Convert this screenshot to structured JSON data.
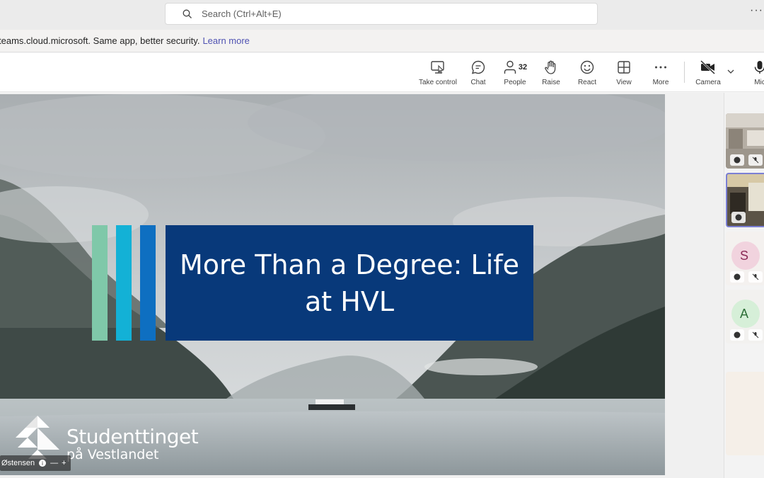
{
  "search": {
    "placeholder": "Search (Ctrl+Alt+E)"
  },
  "banner": {
    "text": "teams.cloud.microsoft. Same app, better security.",
    "link": "Learn more"
  },
  "toolbar": {
    "take_control": "Take control",
    "chat": "Chat",
    "people": "People",
    "people_count": "32",
    "raise": "Raise",
    "react": "React",
    "view": "View",
    "more": "More",
    "camera": "Camera",
    "mic": "Mic"
  },
  "slide": {
    "title": "More Than a Degree: Life at HVL",
    "brand_line1": "Studenttinget",
    "brand_line2": "på Vestlandet"
  },
  "presenter": {
    "name": "Østensen"
  },
  "participants": [
    {
      "initial": "",
      "muted": true
    },
    {
      "initial": "",
      "muted": true,
      "active": true
    },
    {
      "initial": "S",
      "muted": true
    },
    {
      "initial": "A",
      "muted": true
    },
    {
      "initial": ""
    }
  ],
  "colors": {
    "accent": "#4f52b2",
    "title_box": "#08397a",
    "bar_green": "#7fc8a9",
    "bar_cyan": "#13b1d6",
    "bar_blue": "#0e6fc1"
  }
}
